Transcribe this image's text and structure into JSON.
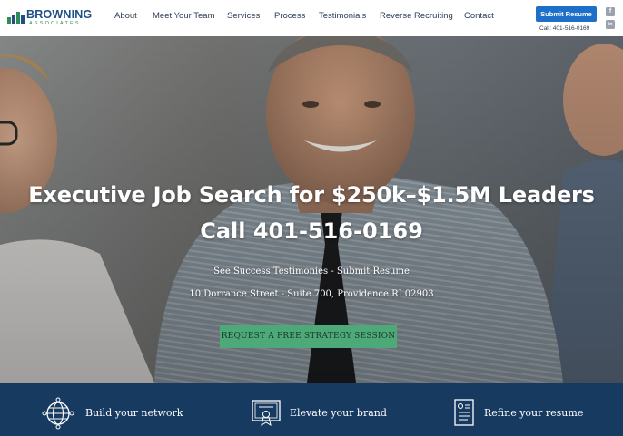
{
  "header": {
    "logo": {
      "name": "BROWNING",
      "sub": "ASSOCIATES"
    },
    "nav": [
      {
        "label": "About"
      },
      {
        "label": "Meet Your Team"
      },
      {
        "label": "Services"
      },
      {
        "label": "Process"
      },
      {
        "label": "Testimonials"
      },
      {
        "label": "Reverse Recruiting"
      },
      {
        "label": "Contact"
      }
    ],
    "submit_label": "Submit Resume",
    "call_small": "Call: 401-516-0169",
    "social": [
      {
        "icon": "facebook-icon",
        "glyph": "f"
      },
      {
        "icon": "linkedin-icon",
        "glyph": "in"
      }
    ]
  },
  "hero": {
    "headline": "Executive Job Search for $250k–$1.5M Leaders",
    "call": "Call 401-516-0169",
    "links": "See Success Testimonies - Submit Resume",
    "address": "10 Dorrance Street - Suite 700, Providence RI 02903",
    "cta_label": "REQUEST A FREE STRATEGY SESSION"
  },
  "features": [
    {
      "label": "Build your network",
      "icon": "globe-network-icon"
    },
    {
      "label": "Elevate your brand",
      "icon": "certificate-icon"
    },
    {
      "label": "Refine your resume",
      "icon": "resume-document-icon"
    }
  ],
  "colors": {
    "brand_blue": "#1f4f86",
    "brand_green": "#2c8c5a",
    "button_blue": "#1d6fc9",
    "cta_green": "#4daa78",
    "band_navy": "#173a61"
  }
}
